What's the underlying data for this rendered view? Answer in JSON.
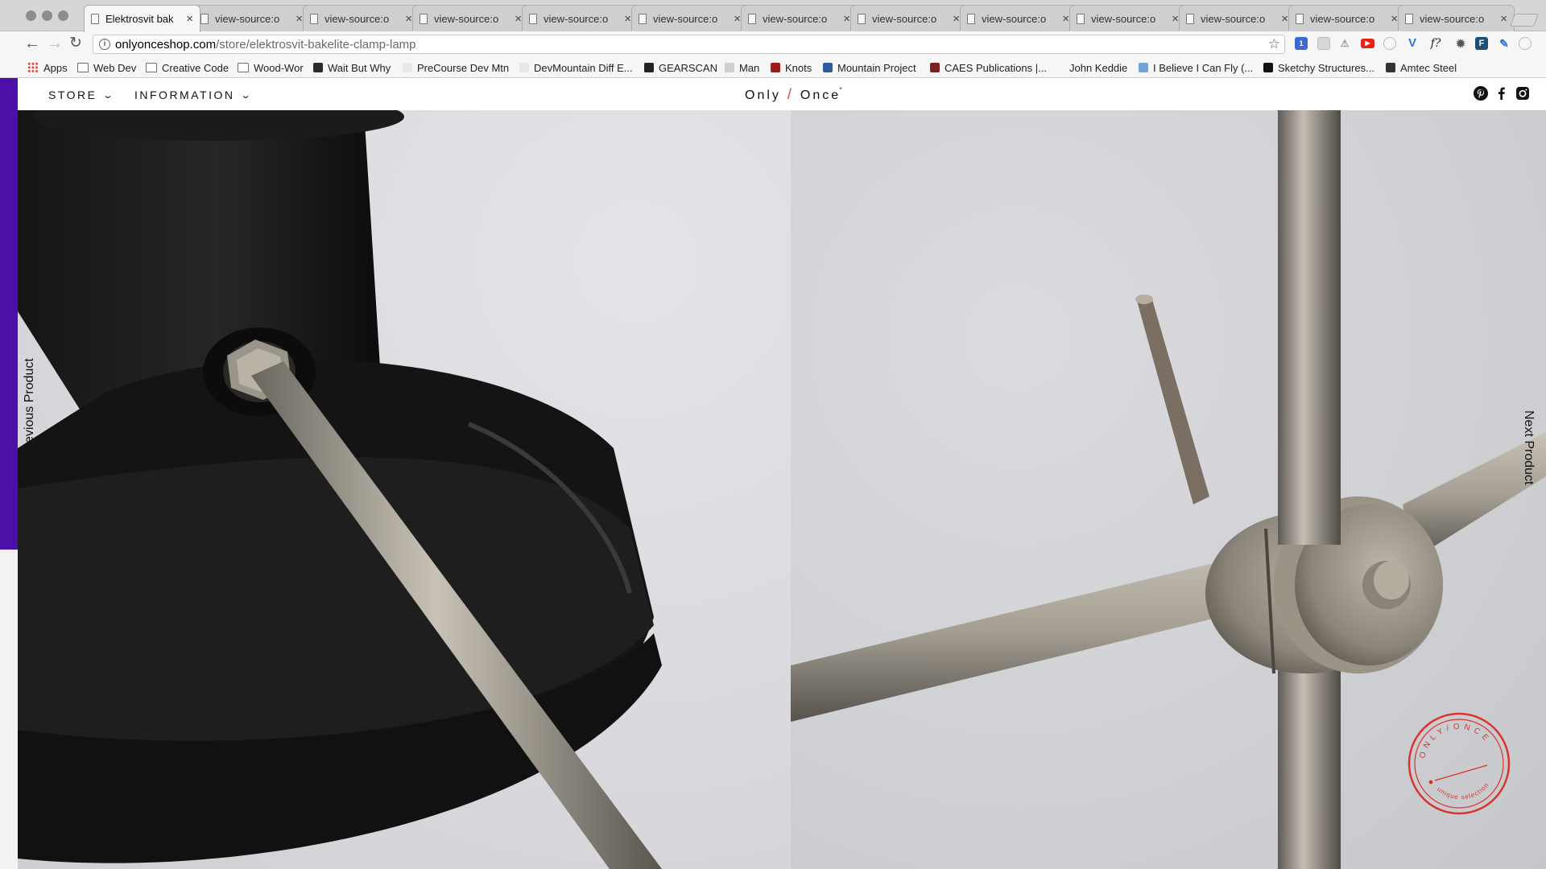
{
  "browser": {
    "tabs": [
      {
        "title": "Elektrosvit bak",
        "active": true
      },
      {
        "title": "view-source:o"
      },
      {
        "title": "view-source:o"
      },
      {
        "title": "view-source:o"
      },
      {
        "title": "view-source:o"
      },
      {
        "title": "view-source:o"
      },
      {
        "title": "view-source:o"
      },
      {
        "title": "view-source:o"
      },
      {
        "title": "view-source:o"
      },
      {
        "title": "view-source:o"
      },
      {
        "title": "view-source:o"
      },
      {
        "title": "view-source:o"
      },
      {
        "title": "view-source:o"
      }
    ],
    "close_glyph": "×",
    "address": {
      "domain": "onlyonceshop.com",
      "path": "/store/elektrosvit-bakelite-clamp-lamp"
    },
    "extension_badge": "1",
    "extension_f_label": "f?",
    "extension_F_label": "F",
    "bookmarks": [
      {
        "label": "Apps",
        "icon": "apps-grid-icon"
      },
      {
        "label": "Web Dev",
        "icon": "folder-icon"
      },
      {
        "label": "Creative Code",
        "icon": "folder-icon"
      },
      {
        "label": "Wood-Wor",
        "icon": "folder-icon"
      },
      {
        "label": "Wait But Why",
        "icon": "waitbutwhy-favicon"
      },
      {
        "label": "PreCourse Dev Mtn",
        "icon": "devmountain-favicon"
      },
      {
        "label": "DevMountain Diff E...",
        "icon": "devmountain-favicon"
      },
      {
        "label": "GEARSCAN",
        "icon": "gearscan-favicon"
      },
      {
        "label": "Man",
        "icon": "man-favicon"
      },
      {
        "label": "Knots",
        "icon": "knots-favicon"
      },
      {
        "label": "Mountain Project",
        "icon": "mountain-project-favicon"
      },
      {
        "label": "CAES Publications |...",
        "icon": "caes-favicon"
      },
      {
        "label": "John Keddie",
        "icon": "blank-favicon"
      },
      {
        "label": "I Believe I Can Fly (...",
        "icon": "image-favicon"
      },
      {
        "label": "Sketchy Structures...",
        "icon": "sketchy-favicon"
      },
      {
        "label": "Amtec Steel",
        "icon": "amtec-favicon"
      }
    ]
  },
  "site": {
    "nav": {
      "store": "STORE",
      "information": "INFORMATION",
      "chevron": "⌄"
    },
    "logo": {
      "left": "Only",
      "slash": "/",
      "right": "Once",
      "mark": "°"
    },
    "social": [
      "pinterest-icon",
      "facebook-icon",
      "instagram-icon"
    ],
    "prev_product": "Previous Product",
    "next_product": "Next Product",
    "stamp": {
      "top_text": "ONLY/ONCE",
      "bottom_text": "unique selection",
      "color": "#d9332c"
    }
  },
  "colors": {
    "accent_red": "#e33a34",
    "sidebar_purple": "#4b10a8"
  }
}
